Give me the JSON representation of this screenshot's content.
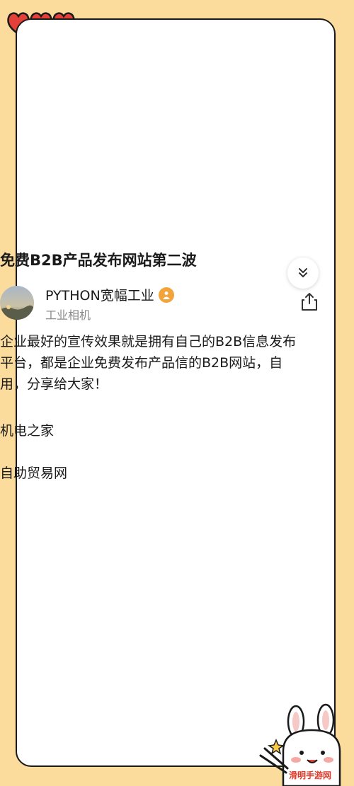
{
  "post": {
    "title": "免费B2B产品发布网站第二波",
    "author_name": "PYTHON宽幅工业",
    "author_subtitle": "工业相机",
    "paragraphs": [
      "企业最好的宣传效果就是拥有自己的B2B信息发布平台，都是企业免费发布产品信的B2B网站，自用，分享给大家！",
      "机电之家",
      "自助贸易网"
    ]
  },
  "colors": {
    "background": "#fbdc9c",
    "card": "#ffffff",
    "heart": "#e4403a",
    "badge": "#f2a33a"
  },
  "icons": [
    "heart-icon",
    "chevron-double-down-icon",
    "share-icon",
    "user-badge-icon"
  ],
  "watermark_text": "滑明手游网"
}
